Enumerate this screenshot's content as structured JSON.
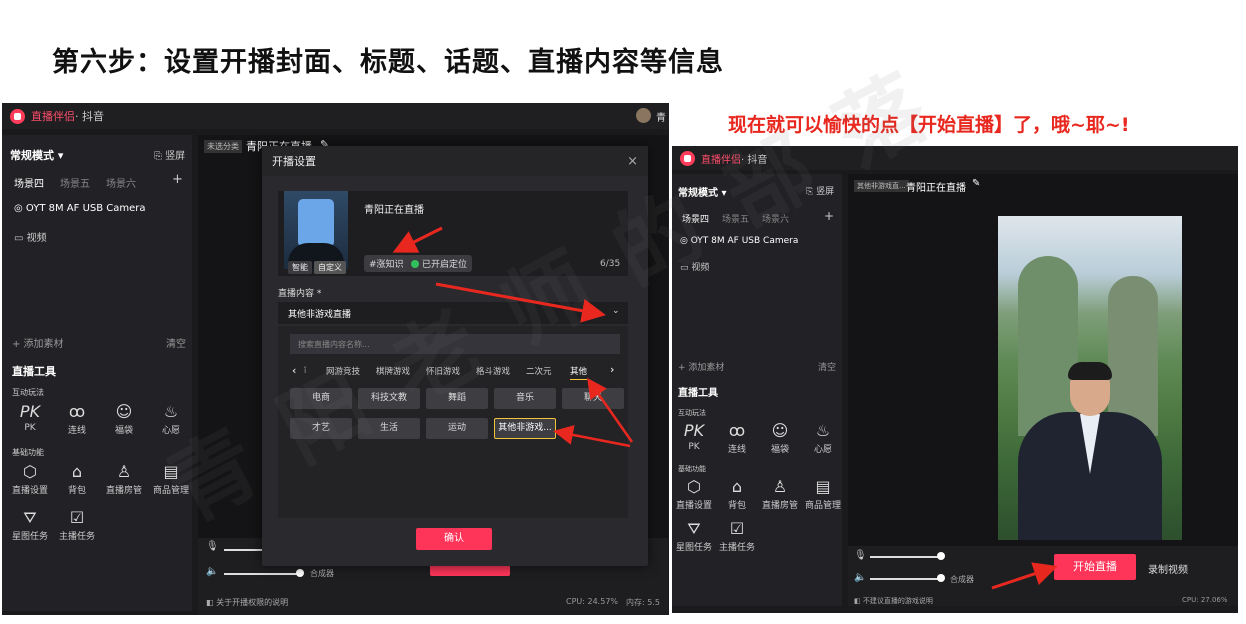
{
  "headings": {
    "step": "第六步：设置开播封面、标题、话题、直播内容等信息",
    "note": "现在就可以愉快的点【开始直播】了，哦~耶~!"
  },
  "app": {
    "brand": "直播伴侣",
    "sep_platform": "· 抖音",
    "accent": "#fe3559"
  },
  "sidebar": {
    "mode": "常规模式 ▾",
    "vertical": "竖屏",
    "scenes": [
      "场景四",
      "场景五",
      "场景六"
    ],
    "add_scene": "+",
    "sources": [
      "OYT 8M AF USB Camera",
      "视频"
    ],
    "add_material": "+ 添加素材",
    "clear": "清空",
    "tools_title": "直播工具",
    "interact_title": "互动玩法",
    "interact_tools": [
      {
        "icon": "pk-icon",
        "glyph": "PK",
        "label": "PK"
      },
      {
        "icon": "link-icon",
        "glyph": "ꝏ",
        "label": "连线"
      },
      {
        "icon": "lucky-bag-icon",
        "glyph": "☺",
        "label": "福袋"
      },
      {
        "icon": "wish-icon",
        "glyph": "♨",
        "label": "心愿"
      }
    ],
    "basic_title": "基础功能",
    "basic_tools": [
      {
        "icon": "settings-icon",
        "glyph": "⬡",
        "label": "直播设置"
      },
      {
        "icon": "bag-icon",
        "glyph": "⌂",
        "label": "背包"
      },
      {
        "icon": "room-manager-icon",
        "glyph": "♙",
        "label": "直播房管"
      },
      {
        "icon": "goods-icon",
        "glyph": "▤",
        "label": "商品管理"
      }
    ],
    "more_tools": [
      {
        "icon": "star-task-icon",
        "glyph": "⛛",
        "label": "星图任务"
      },
      {
        "icon": "anchor-task-icon",
        "glyph": "☑",
        "label": "主播任务"
      }
    ]
  },
  "stage": {
    "category_tag": "未选分类",
    "title": "青阳正在直播",
    "edit_icon": "✎",
    "mixer_label": "合成器",
    "notice": "关于开播权限的说明",
    "cpu": "CPU: 24.57%",
    "memory": "内存: 5.5"
  },
  "modal": {
    "title": "开播设置",
    "close": "×",
    "cover_chips": [
      "智能",
      "自定义"
    ],
    "live_title": "青阳正在直播",
    "topic": "#涨知识",
    "location": "已开启定位",
    "counter": "6/35",
    "content_label": "直播内容 *",
    "content_value": "其他非游戏直播",
    "search_placeholder": "搜索直播内容名称...",
    "tabs": [
      "网游竞技",
      "棋牌游戏",
      "怀旧游戏",
      "格斗游戏",
      "二次元",
      "其他"
    ],
    "active_tab": "其他",
    "categories_row1": [
      "电商",
      "科技文教",
      "舞蹈",
      "音乐",
      "聊天"
    ],
    "categories_row2": [
      "才艺",
      "生活",
      "运动",
      "其他非游戏..."
    ],
    "confirm": "确认"
  },
  "right": {
    "category_tag": "其他非游戏直...",
    "title": "青阳正在直播",
    "start_live": "开始直播",
    "record": "录制视频",
    "notice": "不建议直播的游戏说明",
    "cpu": "CPU: 27.06%",
    "mixer_label": "合成器"
  },
  "watermark": "青阳老师的部落"
}
